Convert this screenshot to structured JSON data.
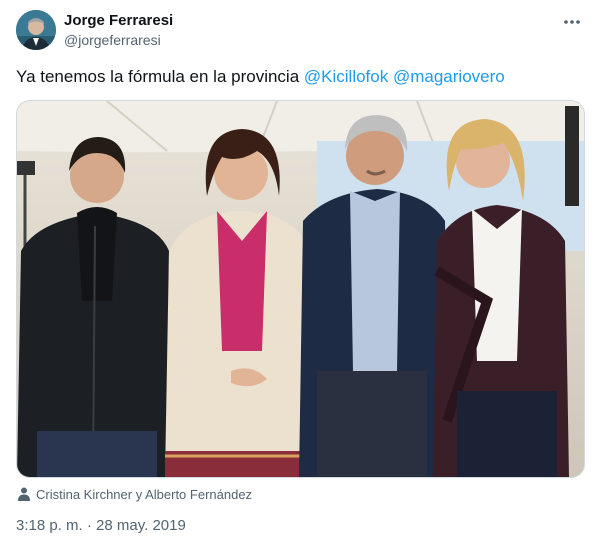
{
  "author": {
    "name": "Jorge Ferraresi",
    "handle": "@jorgeferraresi"
  },
  "tweet": {
    "text": "Ya tenemos la fórmula en la provincia ",
    "mentions": [
      "@Kicillofok",
      "@magariovero"
    ]
  },
  "media": {
    "people_tag": "Cristina Kirchner y Alberto Fernández",
    "tag_icon": "person-icon"
  },
  "meta": {
    "timestamp": "3:18 p. m. · 28 may. 2019"
  },
  "icons": {
    "more": "more-dots-icon"
  },
  "colors": {
    "link": "#1d9bf0",
    "secondary_text": "#536471",
    "primary_text": "#0f1419"
  }
}
